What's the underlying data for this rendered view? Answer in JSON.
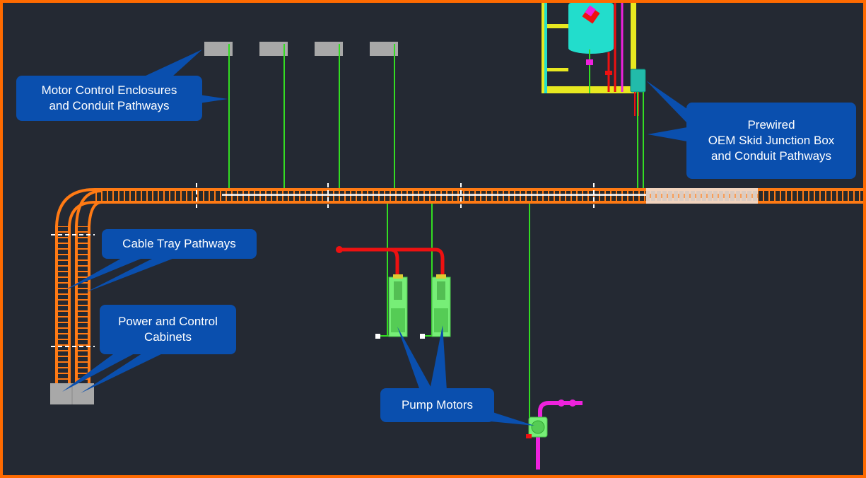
{
  "colors": {
    "frame": "#ff6a00",
    "background": "#242933",
    "callout_fill": "#0a4fae",
    "cable_tray": "#ff7a14",
    "conduit": "#33dd22",
    "red_pipe": "#ee1111",
    "magenta_pipe": "#ee22dd",
    "skid_frame": "#e8e820",
    "tank": "#22ddcc",
    "enclosure_gray": "#a8a8a8",
    "motor_green": "#77ee77"
  },
  "callouts": {
    "motor_control": {
      "lines": [
        "Motor Control Enclosures",
        "and Conduit Pathways"
      ]
    },
    "oem_skid": {
      "lines": [
        "Prewired",
        "OEM Skid Junction Box",
        "and Conduit Pathways"
      ]
    },
    "cable_tray": {
      "lines": [
        "Cable Tray Pathways"
      ]
    },
    "power_control": {
      "lines": [
        "Power and Control",
        "Cabinets"
      ]
    },
    "pump_motors": {
      "lines": [
        "Pump Motors"
      ]
    }
  },
  "equipment": {
    "motor_control_enclosure_count": 4,
    "power_control_cabinet_count": 2,
    "pump_motor_count": 3
  }
}
